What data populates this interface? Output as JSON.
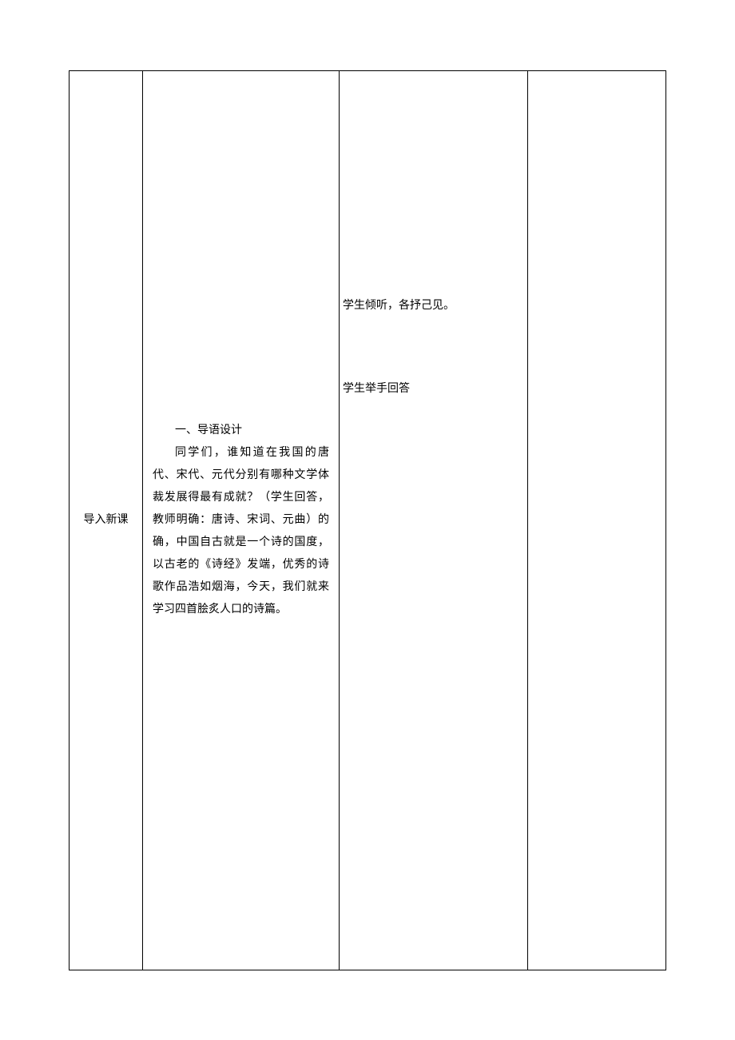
{
  "col1": {
    "label": "导入新课"
  },
  "col2": {
    "section_title": "一、导语设计",
    "paragraph": "同学们，谁知道在我国的唐代、宋代、元代分别有哪种文学体裁发展得最有成就？（学生回答，教师明确：唐诗、宋词、元曲）的确，中国自古就是一个诗的国度，以古老的《诗经》发端，优秀的诗歌作品浩如烟海，今天，我们就来学习四首脍炙人口的诗篇。"
  },
  "col3": {
    "line1": "学生倾听，各抒己见。",
    "line2": "学生举手回答"
  }
}
